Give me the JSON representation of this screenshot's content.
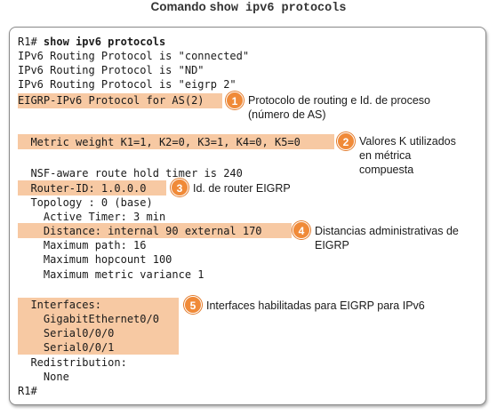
{
  "title": {
    "prefix": "Comando ",
    "command": "show ipv6 protocols"
  },
  "terminal": {
    "prompt_line": {
      "prompt": "R1# ",
      "command": "show ipv6 protocols"
    },
    "lines": [
      "IPv6 Routing Protocol is \"connected\"",
      "IPv6 Routing Protocol is \"ND\"",
      "IPv6 Routing Protocol is \"eigrp 2\"",
      "EIGRP-IPv6 Protocol for AS(2)",
      "",
      "  Metric weight K1=1, K2=0, K3=1, K4=0, K5=0",
      "",
      "  NSF-aware route hold timer is 240",
      "  Router-ID: 1.0.0.0",
      "  Topology : 0 (base)",
      "    Active Timer: 3 min",
      "    Distance: internal 90 external 170",
      "    Maximum path: 16",
      "    Maximum hopcount 100",
      "    Maximum metric variance 1",
      "",
      "  Interfaces:",
      "    GigabitEthernet0/0",
      "    Serial0/0/0",
      "    Serial0/0/1",
      "  Redistribution:",
      "    None",
      "R1#"
    ]
  },
  "callouts": [
    {
      "number": "1",
      "text": "Protocolo de routing e Id. de proceso\n(número de AS)"
    },
    {
      "number": "2",
      "text": "Valores K utilizados\nen métrica\ncompuesta"
    },
    {
      "number": "3",
      "text": "Id. de router EIGRP"
    },
    {
      "number": "4",
      "text": "Distancias administrativas de\nEIGRP"
    },
    {
      "number": "5",
      "text": "Interfaces habilitadas para EIGRP para IPv6"
    }
  ],
  "colors": {
    "highlight": "#f7c9a3",
    "badge": "#f08a38",
    "border": "#8a8a8a"
  }
}
